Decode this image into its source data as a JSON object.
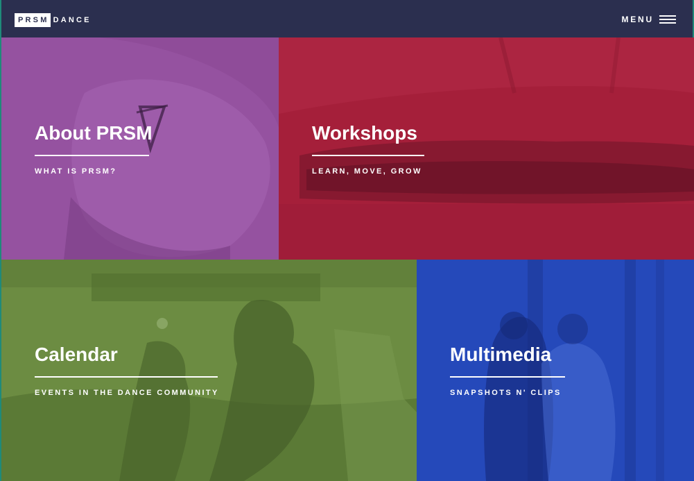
{
  "header": {
    "logo_box": "PRSM",
    "logo_word": "DANCE",
    "menu_label": "MENU"
  },
  "tiles": [
    {
      "title": "About PRSM",
      "subtitle": "WHAT IS PRSM?",
      "color": "#8f4c99"
    },
    {
      "title": "Workshops",
      "subtitle": "LEARN, MOVE, GROW",
      "color": "#a51f3a"
    },
    {
      "title": "Calendar",
      "subtitle": "EVENTS IN THE DANCE COMMUNITY",
      "color": "#6c8c42"
    },
    {
      "title": "Multimedia",
      "subtitle": "SNAPSHOTS N' CLIPS",
      "color": "#2345b5"
    }
  ],
  "colors": {
    "header_bg": "#2b2f4f",
    "text": "#ffffff"
  }
}
